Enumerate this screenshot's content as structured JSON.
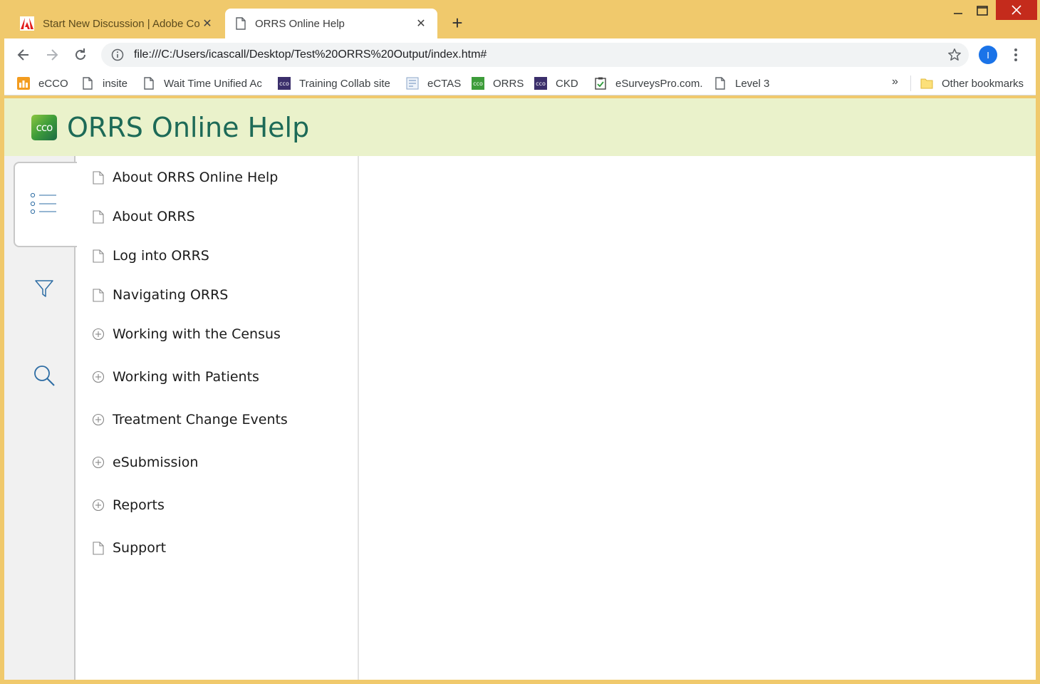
{
  "browser": {
    "tabs": [
      {
        "title": "Start New Discussion | Adobe Co",
        "icon": "adobe-icon",
        "active": false
      },
      {
        "title": "ORRS Online Help",
        "icon": "page-icon",
        "active": true
      }
    ],
    "address": "file:///C:/Users/icascall/Desktop/Test%20ORRS%20Output/index.htm#",
    "profile_initial": "I",
    "bookmarks": [
      {
        "label": "eCCO",
        "icon": "ecco-icon"
      },
      {
        "label": "insite",
        "icon": "page-icon"
      },
      {
        "label": "Wait Time Unified Ac",
        "icon": "page-icon"
      },
      {
        "label": "Training Collab site",
        "icon": "cco-icon"
      },
      {
        "label": "eCTAS",
        "icon": "form-icon"
      },
      {
        "label": "ORRS",
        "icon": "cco-green-icon"
      },
      {
        "label": "CKD",
        "icon": "cco-icon"
      },
      {
        "label": "eSurveysPro.com.",
        "icon": "clipboard-icon"
      },
      {
        "label": "Level 3",
        "icon": "page-icon"
      }
    ],
    "overflow": "»",
    "other_bookmarks": "Other bookmarks"
  },
  "page": {
    "logo_text": "cco",
    "title": "ORRS Online Help",
    "toc": [
      {
        "label": "About ORRS Online Help",
        "icon": "page-icon"
      },
      {
        "label": "About ORRS",
        "icon": "page-icon"
      },
      {
        "label": "Log into ORRS",
        "icon": "page-icon"
      },
      {
        "label": "Navigating ORRS",
        "icon": "page-icon"
      },
      {
        "label": "Working with the Census",
        "icon": "expand-icon"
      },
      {
        "label": "Working with Patients",
        "icon": "expand-icon"
      },
      {
        "label": "Treatment Change Events",
        "icon": "expand-icon"
      },
      {
        "label": "eSubmission",
        "icon": "expand-icon"
      },
      {
        "label": "Reports",
        "icon": "expand-icon"
      },
      {
        "label": "Support",
        "icon": "page-icon"
      }
    ]
  },
  "colors": {
    "frame": "#f0c96c",
    "header_bg": "#eaf2cb",
    "title": "#1d6a57",
    "rail_icon": "#2e6da4"
  }
}
